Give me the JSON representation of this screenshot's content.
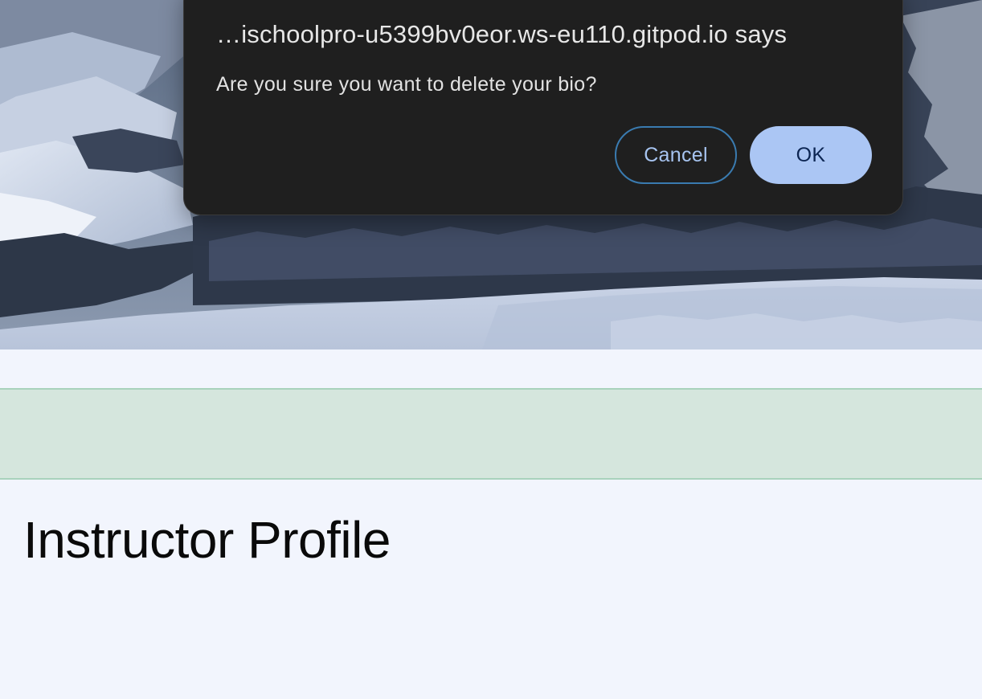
{
  "dialog": {
    "title": "…ischoolpro-u5399bv0eor.ws-eu110.gitpod.io says",
    "message": "Are you sure you want to delete your bio?",
    "cancel_label": "Cancel",
    "ok_label": "OK"
  },
  "page": {
    "title": "Instructor Profile"
  },
  "colors": {
    "background": "#f2f5fd",
    "alert_bg": "#d5e6dd",
    "alert_border": "#a9d2bc",
    "dialog_bg": "#1f1f1f",
    "ok_button": "#abc6f4",
    "cancel_border": "#3a7bb0"
  }
}
